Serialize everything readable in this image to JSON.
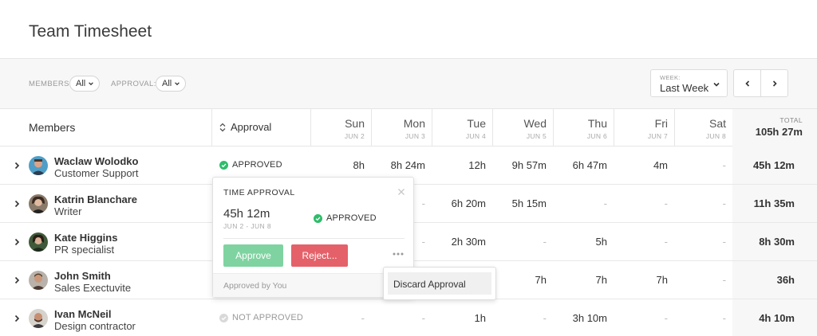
{
  "header": {
    "title": "Team Timesheet"
  },
  "filters": {
    "members_label": "MEMBERS:",
    "members_value": "All",
    "approval_label": "APPROVAL:",
    "approval_value": "All",
    "week_label": "WEEK:",
    "week_value": "Last Week"
  },
  "table": {
    "members_header": "Members",
    "approval_header": "Approval",
    "days": [
      {
        "name": "Sun",
        "date": "JUN 2"
      },
      {
        "name": "Mon",
        "date": "JUN 3"
      },
      {
        "name": "Tue",
        "date": "JUN 4"
      },
      {
        "name": "Wed",
        "date": "JUN 5"
      },
      {
        "name": "Thu",
        "date": "JUN 6"
      },
      {
        "name": "Fri",
        "date": "JUN 7"
      },
      {
        "name": "Sat",
        "date": "JUN 8"
      }
    ],
    "total_label": "TOTAL",
    "total_value": "105h 27m",
    "rows": [
      {
        "name": "Waclaw Wolodko",
        "role": "Customer Support",
        "status": "APPROVED",
        "hours": [
          "8h",
          "8h 24m",
          "12h",
          "9h 57m",
          "6h 47m",
          "4m",
          "-"
        ],
        "total": "45h 12m"
      },
      {
        "name": "Katrin Blanchare",
        "role": "Writer",
        "status": "",
        "hours": [
          "",
          "-",
          "6h 20m",
          "5h 15m",
          "-",
          "-",
          "-"
        ],
        "total": "11h 35m"
      },
      {
        "name": "Kate Higgins",
        "role": "PR specialist",
        "status": "",
        "hours": [
          "",
          "-",
          "2h 30m",
          "-",
          "5h",
          "-",
          "-"
        ],
        "total": "8h 30m"
      },
      {
        "name": "John Smith",
        "role": "Sales Exectuvite",
        "status": "",
        "hours": [
          "",
          "",
          "",
          "7h",
          "7h",
          "7h",
          "-"
        ],
        "total": "36h"
      },
      {
        "name": "Ivan McNeil",
        "role": "Design contractor",
        "status": "NOT APPROVED",
        "hours": [
          "-",
          "-",
          "1h",
          "-",
          "3h 10m",
          "-",
          "-"
        ],
        "total": "4h 10m"
      }
    ]
  },
  "popover": {
    "title": "TIME APPROVAL",
    "hours": "45h 12m",
    "range": "JUN 2 - JUN 8",
    "status": "APPROVED",
    "approve_label": "Approve",
    "reject_label": "Reject...",
    "footer": "Approved by You"
  },
  "dropdown": {
    "item": "Discard Approval"
  },
  "colors": {
    "approved": "#2ebd6b",
    "approve_button": "#7fd3a1",
    "reject_button": "#e4616a"
  }
}
